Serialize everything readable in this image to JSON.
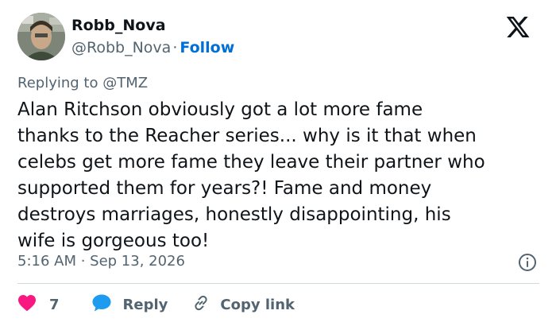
{
  "author": {
    "display_name": "Robb_Nova",
    "handle": "@Robb_Nova",
    "separator": "·",
    "follow_label": "Follow",
    "avatar_icon": "avatar-photo"
  },
  "brand": {
    "logo_icon": "x-logo-icon",
    "logo_color": "#0f1419"
  },
  "reply_context": "Replying to @TMZ",
  "tweet_text": "Alan Ritchson obviously got a lot more fame\nthanks to the Reacher series... why is it that when\ncelebs get more fame they leave their partner who\nsupported them for years?!  Fame and money\ndestroys marriages, honestly disappointing, his\nwife is gorgeous too!",
  "timestamp": "5:16 AM · Sep 13, 2026",
  "info_icon": "info-icon",
  "actions": {
    "like_count": "7",
    "like_icon": "heart-icon",
    "like_color": "#f91880",
    "reply_label": "Reply",
    "reply_icon": "reply-bubble-icon",
    "reply_color": "#1d9bf0",
    "copy_label": "Copy link",
    "copy_icon": "link-icon"
  },
  "colors": {
    "text_primary": "#0f1419",
    "text_secondary": "#536471",
    "link": "#006fd6",
    "divider": "#cfd9de"
  }
}
